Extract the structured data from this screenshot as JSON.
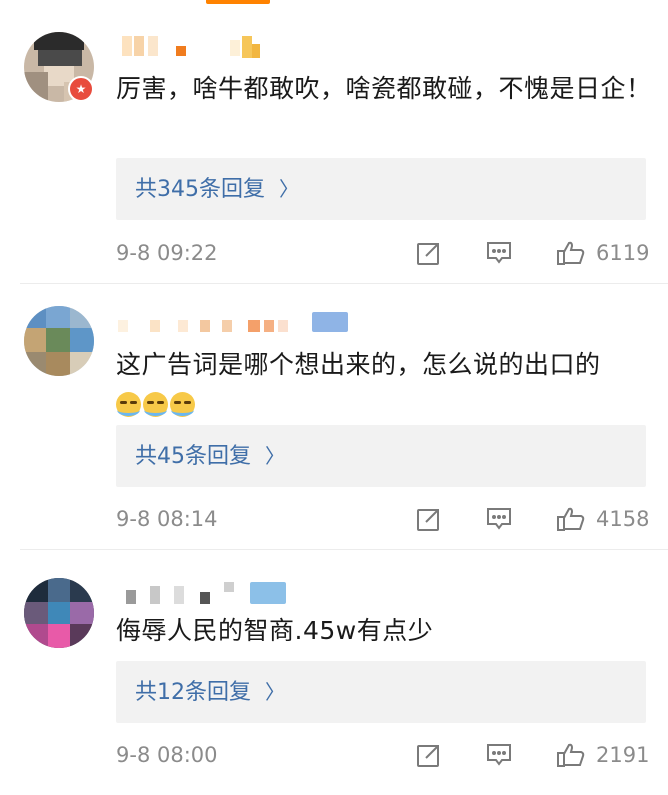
{
  "colors": {
    "accent": "#ff8200",
    "reply_link": "#3f6ea8",
    "meta_text": "#8b8b8b",
    "reply_bg": "#f2f2f2"
  },
  "comments": [
    {
      "content": "厉害，啥牛都敢吹，啥瓷都敢碰，不愧是日企！",
      "reply_label": "共345条回复",
      "time": "9-8 09:22",
      "likes": "6119",
      "verified_badge": "★"
    },
    {
      "content": "这广告词是哪个想出来的，怎么说的出口的",
      "emoji": [
        "laugh-cry",
        "laugh-cry",
        "laugh-cry"
      ],
      "reply_label": "共45条回复",
      "time": "9-8 08:14",
      "likes": "4158"
    },
    {
      "content": "侮辱人民的智商.45w有点少",
      "reply_label": "共12条回复",
      "time": "9-8 08:00",
      "likes": "2191"
    }
  ],
  "icons": {
    "share": "share-icon",
    "comment": "comment-icon",
    "like": "thumbs-up-icon",
    "arrow": "chevron-right-icon"
  },
  "reply_arrow": "〉"
}
